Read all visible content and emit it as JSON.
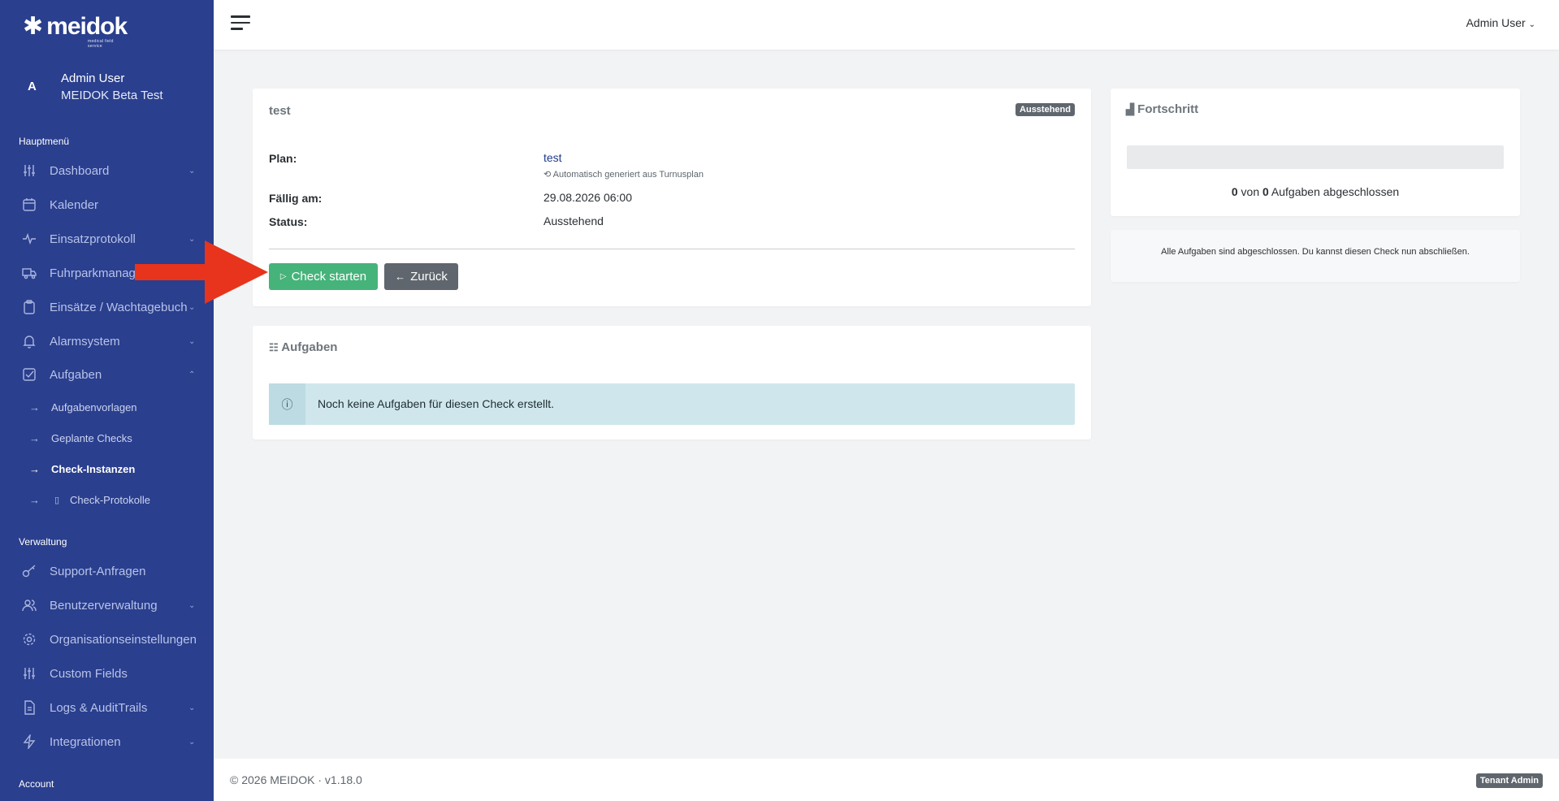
{
  "brand": {
    "name": "meidok",
    "tagline": "medical field service"
  },
  "sidebar": {
    "user": {
      "avatar_letter": "A",
      "name": "Admin User",
      "tenant": "MEIDOK Beta Test"
    },
    "section_main": "Hauptmenü",
    "main_items": [
      {
        "label": "Dashboard",
        "icon": "sliders-icon",
        "has_chevron": true
      },
      {
        "label": "Kalender",
        "icon": "calendar-icon",
        "has_chevron": false
      },
      {
        "label": "Einsatzprotokoll",
        "icon": "activity-icon",
        "has_chevron": true
      },
      {
        "label": "Fuhrparkmanagement",
        "icon": "truck-icon",
        "has_chevron": false
      },
      {
        "label": "Einsätze / Wachtagebuch",
        "icon": "clipboard-icon",
        "has_chevron": true
      },
      {
        "label": "Alarmsystem",
        "icon": "bell-icon",
        "has_chevron": true
      },
      {
        "label": "Aufgaben",
        "icon": "check-square-icon",
        "has_chevron": true
      }
    ],
    "sub_items": [
      {
        "label": "Aufgabenvorlagen"
      },
      {
        "label": "Geplante Checks"
      },
      {
        "label": "Check-Instanzen"
      },
      {
        "label": "Check-Protokolle"
      }
    ],
    "section_admin": "Verwaltung",
    "admin_items": [
      {
        "label": "Support-Anfragen",
        "icon": "key-icon"
      },
      {
        "label": "Benutzerverwaltung",
        "icon": "users-icon"
      },
      {
        "label": "Organisationseinstellungen",
        "icon": "gear-icon"
      },
      {
        "label": "Custom Fields",
        "icon": "sliders-icon"
      },
      {
        "label": "Logs & AuditTrails",
        "icon": "file-text-icon"
      },
      {
        "label": "Integrationen",
        "icon": "zap-icon"
      }
    ],
    "account_label": "Account"
  },
  "topbar": {
    "user_label": "Admin User"
  },
  "check": {
    "title": "test",
    "status_badge": "Ausstehend",
    "plan_label": "Plan:",
    "plan_value": "test",
    "plan_note": "Automatisch generiert aus Turnusplan",
    "due_label": "Fällig am:",
    "due_value": "29.08.2026 06:00",
    "status_label": "Status:",
    "status_value": "Ausstehend",
    "start_button": "Check starten",
    "back_button": "Zurück"
  },
  "tasks": {
    "title": "Aufgaben",
    "empty_message": "Noch keine Aufgaben für diesen Check erstellt."
  },
  "progress": {
    "title": "Fortschritt",
    "done": 0,
    "total": 0,
    "done_text": "0",
    "of_text": "von",
    "total_text": "0",
    "suffix": "Aufgaben abgeschlossen",
    "fraction": 0,
    "note": "Alle Aufgaben sind abgeschlossen. Du kannst diesen Check nun abschließen."
  },
  "footer": {
    "copyright": "© 2026 MEIDOK · v1.18.0",
    "role_badge": "Tenant Admin"
  },
  "colors": {
    "sidebar": "#2a3f8d",
    "primary_green": "#46b37a",
    "badge_grey": "#5f666d",
    "info_bg": "#cfe7ec",
    "annotation_red": "#e8341c"
  }
}
